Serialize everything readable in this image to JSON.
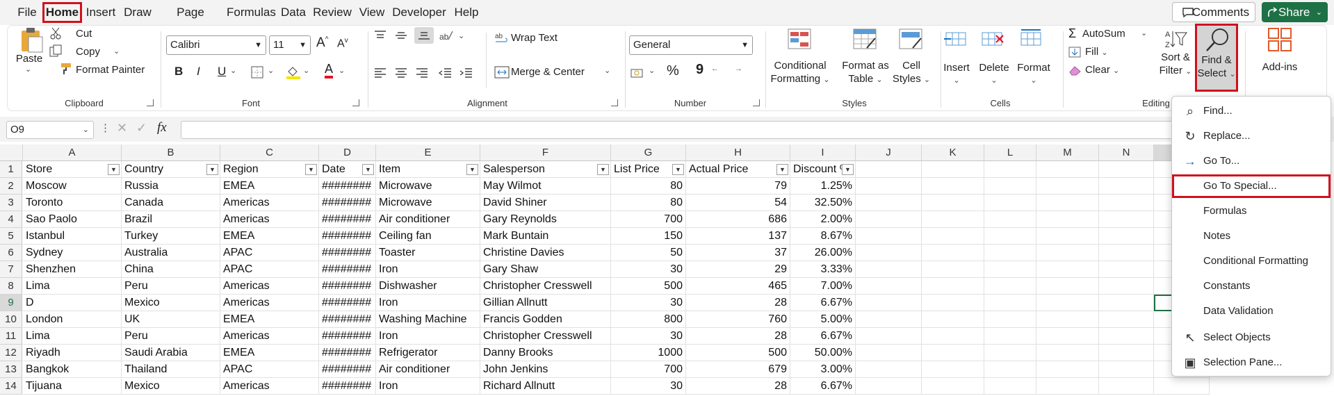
{
  "tabs": [
    "File",
    "Home",
    "Insert",
    "Draw",
    "Page Layout",
    "Formulas",
    "Data",
    "Review",
    "View",
    "Developer",
    "Help"
  ],
  "active_tab": "Home",
  "header": {
    "comments": "Comments",
    "share": "Share"
  },
  "ribbon": {
    "clipboard": {
      "group": "Clipboard",
      "paste": "Paste",
      "cut": "Cut",
      "copy": "Copy",
      "format_painter": "Format Painter"
    },
    "font": {
      "group": "Font",
      "font_name": "Calibri",
      "font_size": "11",
      "bold": "B",
      "italic": "I",
      "underline": "U",
      "grow": "A",
      "shrink": "A",
      "font_color": "A"
    },
    "alignment": {
      "group": "Alignment",
      "wrap_text": "Wrap Text",
      "merge_center": "Merge & Center"
    },
    "number": {
      "group": "Number",
      "format": "General",
      "percent": "%",
      "comma": "9",
      ",0_to_.00": ".00",
      ".00_to_.0": ".0"
    },
    "styles": {
      "group": "Styles",
      "conditional_1": "Conditional",
      "conditional_2": "Formatting",
      "format_as_1": "Format as",
      "format_as_2": "Table",
      "cell_styles_1": "Cell",
      "cell_styles_2": "Styles"
    },
    "cells": {
      "group": "Cells",
      "insert": "Insert",
      "delete": "Delete",
      "format": "Format"
    },
    "editing": {
      "group": "Editing",
      "autosum": "AutoSum",
      "fill": "Fill",
      "clear": "Clear",
      "sort_1": "Sort &",
      "sort_2": "Filter",
      "find_1": "Find &",
      "find_2": "Select"
    },
    "addins": {
      "label": "Add-ins"
    }
  },
  "formula_bar": {
    "name_box": "O9",
    "fx": "fx",
    "value": ""
  },
  "columns": [
    "A",
    "B",
    "C",
    "D",
    "E",
    "F",
    "G",
    "H",
    "I",
    "J",
    "K",
    "L",
    "M",
    "N",
    "O"
  ],
  "headers": [
    "Store",
    "Country",
    "Region",
    "Date",
    "Item",
    "Salesperson",
    "List Price",
    "Actual Price",
    "Discount %"
  ],
  "rows": [
    [
      "Moscow",
      "Russia",
      "EMEA",
      "########",
      "Microwave",
      "May Wilmot",
      "80",
      "79",
      "1.25%"
    ],
    [
      "Toronto",
      "Canada",
      "Americas",
      "########",
      "Microwave",
      "David Shiner",
      "80",
      "54",
      "32.50%"
    ],
    [
      "Sao Paolo",
      "Brazil",
      "Americas",
      "########",
      "Air conditioner",
      "Gary Reynolds",
      "700",
      "686",
      "2.00%"
    ],
    [
      "Istanbul",
      "Turkey",
      "EMEA",
      "########",
      "Ceiling fan",
      "Mark Buntain",
      "150",
      "137",
      "8.67%"
    ],
    [
      "Sydney",
      "Australia",
      "APAC",
      "########",
      "Toaster",
      "Christine Davies",
      "50",
      "37",
      "26.00%"
    ],
    [
      "Shenzhen",
      "China",
      "APAC",
      "########",
      "Iron",
      "Gary Shaw",
      "30",
      "29",
      "3.33%"
    ],
    [
      "Lima",
      "Peru",
      "Americas",
      "########",
      "Dishwasher",
      "Christopher Cresswell",
      "500",
      "465",
      "7.00%"
    ],
    [
      "D",
      "Mexico",
      "Americas",
      "########",
      "Iron",
      "Gillian Allnutt",
      "30",
      "28",
      "6.67%"
    ],
    [
      "London",
      "UK",
      "EMEA",
      "########",
      "Washing Machine",
      "Francis Godden",
      "800",
      "760",
      "5.00%"
    ],
    [
      "Lima",
      "Peru",
      "Americas",
      "########",
      "Iron",
      "Christopher Cresswell",
      "30",
      "28",
      "6.67%"
    ],
    [
      "Riyadh",
      "Saudi Arabia",
      "EMEA",
      "########",
      "Refrigerator",
      "Danny Brooks",
      "1000",
      "500",
      "50.00%"
    ],
    [
      "Bangkok",
      "Thailand",
      "APAC",
      "########",
      "Air conditioner",
      "John Jenkins",
      "700",
      "679",
      "3.00%"
    ],
    [
      "Tijuana",
      "Mexico",
      "Americas",
      "########",
      "Iron",
      "Richard Allnutt",
      "30",
      "28",
      "6.67%"
    ]
  ],
  "row_numbers": [
    "1",
    "2",
    "3",
    "4",
    "5",
    "6",
    "7",
    "8",
    "9",
    "10",
    "11",
    "12",
    "13",
    "14"
  ],
  "find_menu": [
    {
      "label": "Find...",
      "icon": "search-icon"
    },
    {
      "label": "Replace...",
      "icon": "replace-icon"
    },
    {
      "label": "Go To...",
      "icon": "arrow-right-icon"
    },
    {
      "label": "Go To Special...",
      "icon": ""
    },
    {
      "label": "Formulas",
      "icon": ""
    },
    {
      "label": "Notes",
      "icon": ""
    },
    {
      "label": "Conditional Formatting",
      "icon": ""
    },
    {
      "label": "Constants",
      "icon": ""
    },
    {
      "label": "Data Validation",
      "icon": ""
    },
    {
      "label": "Select Objects",
      "icon": "cursor-icon"
    },
    {
      "label": "Selection Pane...",
      "icon": "selection-pane-icon"
    }
  ],
  "highlight_color": "#d1101e",
  "accent_green": "#1e7145"
}
